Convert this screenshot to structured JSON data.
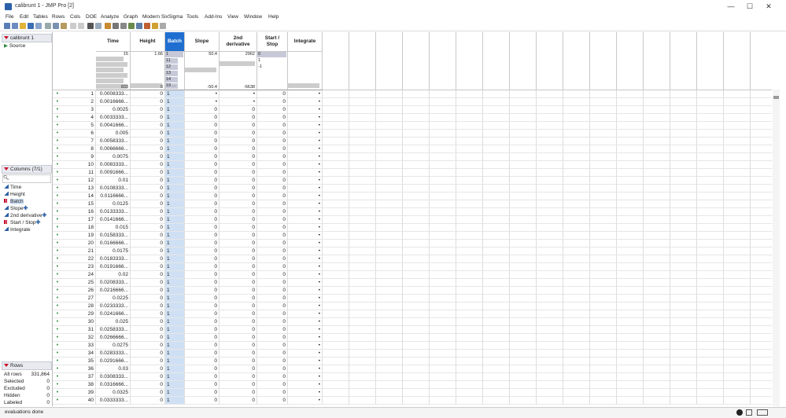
{
  "window": {
    "title": "calibrunt 1 - JMP Pro [2]",
    "minimize": "—",
    "maximize": "☐",
    "close": "✕"
  },
  "menu": [
    "File",
    "Edit",
    "Tables",
    "Rows",
    "Cols",
    "DOE",
    "Analyze",
    "Graph",
    "Modern SixSigma",
    "Tools",
    "Add-Ins",
    "View",
    "Window",
    "Help"
  ],
  "table_panel": {
    "name": "calibrunt 1",
    "source": "Source"
  },
  "columns_panel": {
    "header": "Columns (7/1)",
    "items": [
      {
        "name": "Time",
        "type": "continuous",
        "plus": ""
      },
      {
        "name": "Height",
        "type": "continuous",
        "plus": ""
      },
      {
        "name": "Batch",
        "type": "nominal",
        "plus": ""
      },
      {
        "name": "Slope",
        "type": "continuous",
        "plus": "✚"
      },
      {
        "name": "2nd derivative",
        "type": "continuous",
        "plus": "✚"
      },
      {
        "name": "Start / Stop",
        "type": "nominal",
        "plus": "✚"
      },
      {
        "name": "Integrate",
        "type": "continuous",
        "plus": ""
      }
    ]
  },
  "rows_panel": {
    "header": "Rows",
    "items": [
      {
        "label": "All rows",
        "value": "331,864"
      },
      {
        "label": "Selected",
        "value": "0"
      },
      {
        "label": "Excluded",
        "value": "0"
      },
      {
        "label": "Hidden",
        "value": "0"
      },
      {
        "label": "Labeled",
        "value": "0"
      }
    ]
  },
  "grid": {
    "headers": [
      "Time",
      "Height",
      "Batch",
      "Slope",
      "2nd\nderivative",
      "Start /\nStop",
      "Integrate"
    ],
    "hist": {
      "time_top": "15",
      "time_bottom": "833",
      "height_top": "1.66",
      "height_bottom": "0",
      "batch_vals": [
        "1",
        "11",
        "12",
        "13",
        "14",
        "19 ..."
      ],
      "slope_top": "50.4",
      "slope_bottom": "-50.4",
      "deriv_top": "2962",
      "deriv_bottom": "-6638",
      "start_vals": [
        "0",
        "1",
        "-1"
      ]
    },
    "rows": [
      {
        "n": "1",
        "time": "0.0008333...",
        "height": "0",
        "batch": "1",
        "slope": "•",
        "deriv": "•",
        "start": "0",
        "integ": "•"
      },
      {
        "n": "2",
        "time": "0.0016666...",
        "height": "0",
        "batch": "1",
        "slope": "•",
        "deriv": "•",
        "start": "0",
        "integ": "•"
      },
      {
        "n": "3",
        "time": "0.0025",
        "height": "0",
        "batch": "1",
        "slope": "0",
        "deriv": "0",
        "start": "0",
        "integ": "•"
      },
      {
        "n": "4",
        "time": "0.0033333...",
        "height": "0",
        "batch": "1",
        "slope": "0",
        "deriv": "0",
        "start": "0",
        "integ": "•"
      },
      {
        "n": "5",
        "time": "0.0041666...",
        "height": "0",
        "batch": "1",
        "slope": "0",
        "deriv": "0",
        "start": "0",
        "integ": "•"
      },
      {
        "n": "6",
        "time": "0.005",
        "height": "0",
        "batch": "1",
        "slope": "0",
        "deriv": "0",
        "start": "0",
        "integ": "•"
      },
      {
        "n": "7",
        "time": "0.0058333...",
        "height": "0",
        "batch": "1",
        "slope": "0",
        "deriv": "0",
        "start": "0",
        "integ": "•"
      },
      {
        "n": "8",
        "time": "0.0066666...",
        "height": "0",
        "batch": "1",
        "slope": "0",
        "deriv": "0",
        "start": "0",
        "integ": "•"
      },
      {
        "n": "9",
        "time": "0.0075",
        "height": "0",
        "batch": "1",
        "slope": "0",
        "deriv": "0",
        "start": "0",
        "integ": "•"
      },
      {
        "n": "10",
        "time": "0.0083333...",
        "height": "0",
        "batch": "1",
        "slope": "0",
        "deriv": "0",
        "start": "0",
        "integ": "•"
      },
      {
        "n": "11",
        "time": "0.0091666...",
        "height": "0",
        "batch": "1",
        "slope": "0",
        "deriv": "0",
        "start": "0",
        "integ": "•"
      },
      {
        "n": "12",
        "time": "0.01",
        "height": "0",
        "batch": "1",
        "slope": "0",
        "deriv": "0",
        "start": "0",
        "integ": "•"
      },
      {
        "n": "13",
        "time": "0.0108333...",
        "height": "0",
        "batch": "1",
        "slope": "0",
        "deriv": "0",
        "start": "0",
        "integ": "•"
      },
      {
        "n": "14",
        "time": "0.0116666...",
        "height": "0",
        "batch": "1",
        "slope": "0",
        "deriv": "0",
        "start": "0",
        "integ": "•"
      },
      {
        "n": "15",
        "time": "0.0125",
        "height": "0",
        "batch": "1",
        "slope": "0",
        "deriv": "0",
        "start": "0",
        "integ": "•"
      },
      {
        "n": "16",
        "time": "0.0133333...",
        "height": "0",
        "batch": "1",
        "slope": "0",
        "deriv": "0",
        "start": "0",
        "integ": "•"
      },
      {
        "n": "17",
        "time": "0.0141666...",
        "height": "0",
        "batch": "1",
        "slope": "0",
        "deriv": "0",
        "start": "0",
        "integ": "•"
      },
      {
        "n": "18",
        "time": "0.015",
        "height": "0",
        "batch": "1",
        "slope": "0",
        "deriv": "0",
        "start": "0",
        "integ": "•"
      },
      {
        "n": "19",
        "time": "0.0158333...",
        "height": "0",
        "batch": "1",
        "slope": "0",
        "deriv": "0",
        "start": "0",
        "integ": "•"
      },
      {
        "n": "20",
        "time": "0.0166666...",
        "height": "0",
        "batch": "1",
        "slope": "0",
        "deriv": "0",
        "start": "0",
        "integ": "•"
      },
      {
        "n": "21",
        "time": "0.0175",
        "height": "0",
        "batch": "1",
        "slope": "0",
        "deriv": "0",
        "start": "0",
        "integ": "•"
      },
      {
        "n": "22",
        "time": "0.0183333...",
        "height": "0",
        "batch": "1",
        "slope": "0",
        "deriv": "0",
        "start": "0",
        "integ": "•"
      },
      {
        "n": "23",
        "time": "0.0191666...",
        "height": "0",
        "batch": "1",
        "slope": "0",
        "deriv": "0",
        "start": "0",
        "integ": "•"
      },
      {
        "n": "24",
        "time": "0.02",
        "height": "0",
        "batch": "1",
        "slope": "0",
        "deriv": "0",
        "start": "0",
        "integ": "•"
      },
      {
        "n": "25",
        "time": "0.0208333...",
        "height": "0",
        "batch": "1",
        "slope": "0",
        "deriv": "0",
        "start": "0",
        "integ": "•"
      },
      {
        "n": "26",
        "time": "0.0216666...",
        "height": "0",
        "batch": "1",
        "slope": "0",
        "deriv": "0",
        "start": "0",
        "integ": "•"
      },
      {
        "n": "27",
        "time": "0.0225",
        "height": "0",
        "batch": "1",
        "slope": "0",
        "deriv": "0",
        "start": "0",
        "integ": "•"
      },
      {
        "n": "28",
        "time": "0.0233333...",
        "height": "0",
        "batch": "1",
        "slope": "0",
        "deriv": "0",
        "start": "0",
        "integ": "•"
      },
      {
        "n": "29",
        "time": "0.0241666...",
        "height": "0",
        "batch": "1",
        "slope": "0",
        "deriv": "0",
        "start": "0",
        "integ": "•"
      },
      {
        "n": "30",
        "time": "0.025",
        "height": "0",
        "batch": "1",
        "slope": "0",
        "deriv": "0",
        "start": "0",
        "integ": "•"
      },
      {
        "n": "31",
        "time": "0.0258333...",
        "height": "0",
        "batch": "1",
        "slope": "0",
        "deriv": "0",
        "start": "0",
        "integ": "•"
      },
      {
        "n": "32",
        "time": "0.0266666...",
        "height": "0",
        "batch": "1",
        "slope": "0",
        "deriv": "0",
        "start": "0",
        "integ": "•"
      },
      {
        "n": "33",
        "time": "0.0275",
        "height": "0",
        "batch": "1",
        "slope": "0",
        "deriv": "0",
        "start": "0",
        "integ": "•"
      },
      {
        "n": "34",
        "time": "0.0283333...",
        "height": "0",
        "batch": "1",
        "slope": "0",
        "deriv": "0",
        "start": "0",
        "integ": "•"
      },
      {
        "n": "35",
        "time": "0.0291666...",
        "height": "0",
        "batch": "1",
        "slope": "0",
        "deriv": "0",
        "start": "0",
        "integ": "•"
      },
      {
        "n": "36",
        "time": "0.03",
        "height": "0",
        "batch": "1",
        "slope": "0",
        "deriv": "0",
        "start": "0",
        "integ": "•"
      },
      {
        "n": "37",
        "time": "0.0308333...",
        "height": "0",
        "batch": "1",
        "slope": "0",
        "deriv": "0",
        "start": "0",
        "integ": "•"
      },
      {
        "n": "38",
        "time": "0.0316666...",
        "height": "0",
        "batch": "1",
        "slope": "0",
        "deriv": "0",
        "start": "0",
        "integ": "•"
      },
      {
        "n": "39",
        "time": "0.0325",
        "height": "0",
        "batch": "1",
        "slope": "0",
        "deriv": "0",
        "start": "0",
        "integ": "•"
      },
      {
        "n": "40",
        "time": "0.0333333...",
        "height": "0",
        "batch": "1",
        "slope": "0",
        "deriv": "0",
        "start": "0",
        "integ": "•"
      }
    ]
  },
  "status": {
    "text": "evaluations done"
  },
  "colors": {
    "accent": "#2b5fa8",
    "selected_col": "#cfe0f4",
    "header_sel": "#1f6fd0",
    "red": "#c8102e"
  }
}
